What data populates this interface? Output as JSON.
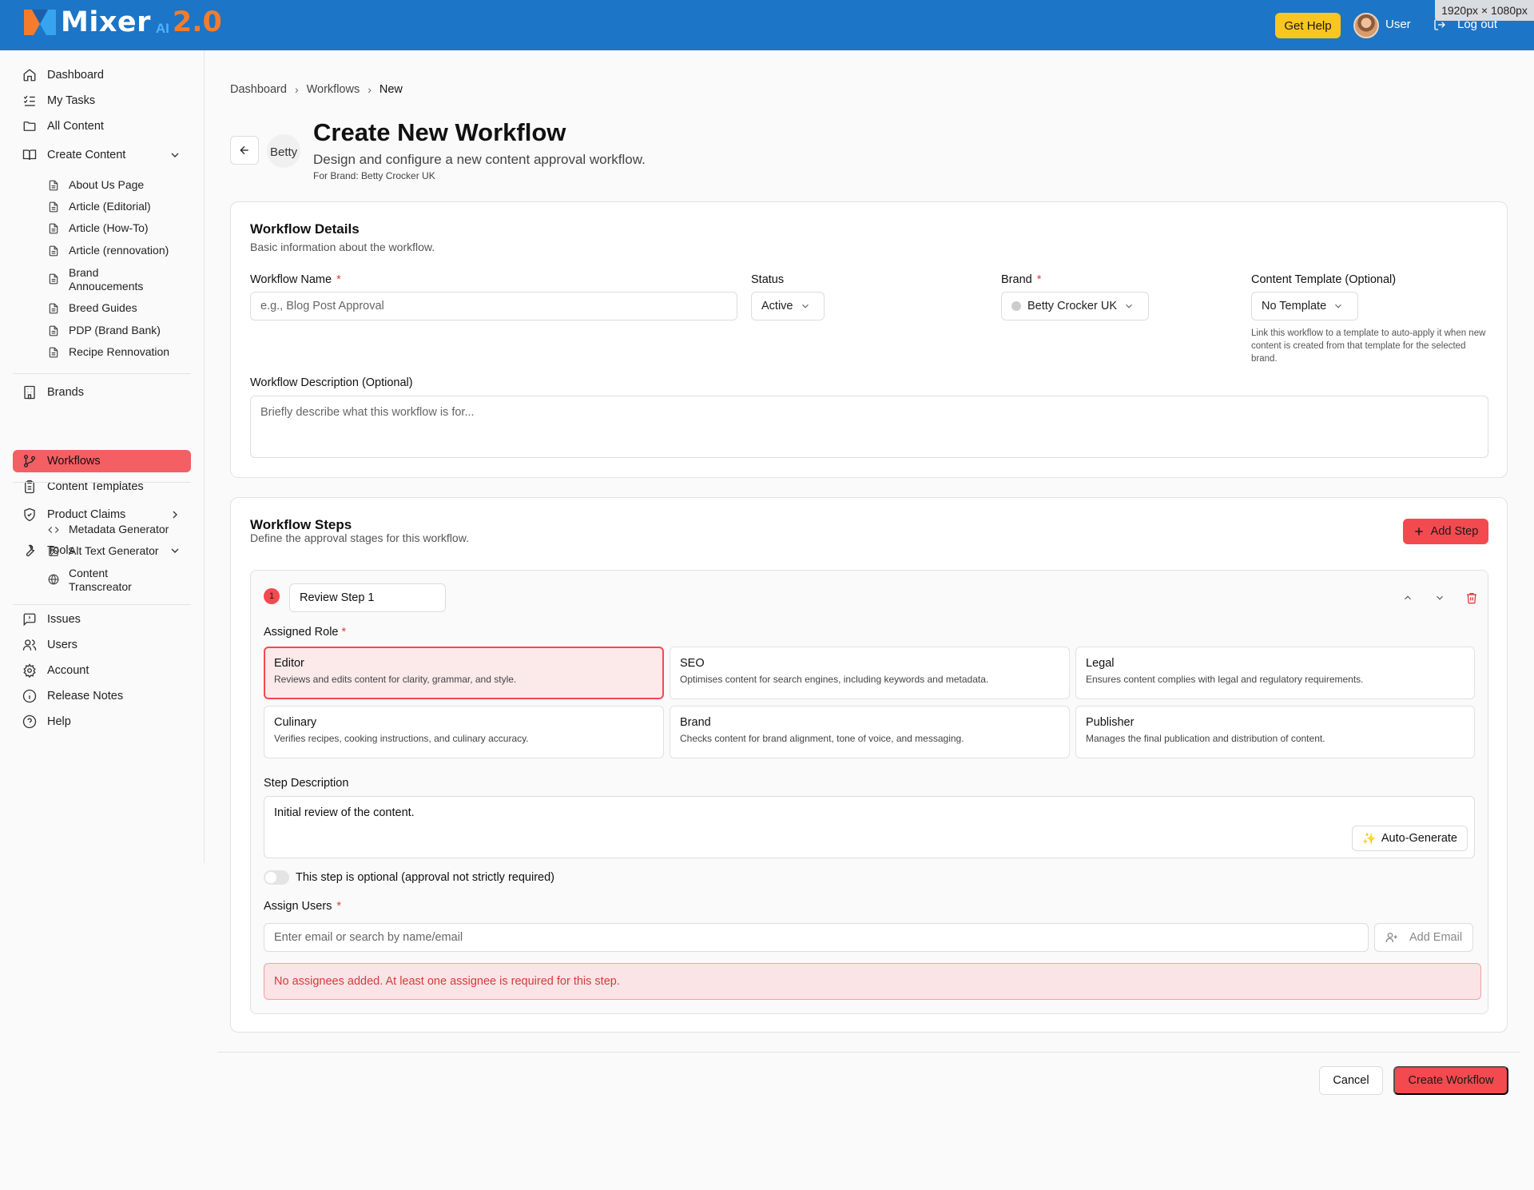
{
  "header": {
    "logo_text": "Mixer",
    "logo_ai": "AI",
    "logo_version": "2.0",
    "get_help_label": "Get Help",
    "user_label": "User",
    "logout_label": "Log out",
    "dimensions_badge": "1920px × 1080px",
    "brand_color": "#1c75c6",
    "accent_color": "#f24a4f"
  },
  "sidebar": {
    "items": [
      {
        "label": "Dashboard",
        "icon": "home-icon"
      },
      {
        "label": "My Tasks",
        "icon": "list-check-icon"
      },
      {
        "label": "All Content",
        "icon": "folder-icon"
      },
      {
        "label": "Create Content",
        "icon": "book-open-icon"
      },
      {
        "label": "Brands",
        "icon": "building-icon"
      },
      {
        "label": "Workflows",
        "icon": "git-branch-icon"
      },
      {
        "label": "Content Templates",
        "icon": "clipboard-icon"
      },
      {
        "label": "Product Claims",
        "icon": "shield-check-icon"
      },
      {
        "label": "Tools",
        "icon": "wrench-icon"
      },
      {
        "label": "Issues",
        "icon": "message-alert-icon"
      },
      {
        "label": "Users",
        "icon": "users-icon"
      },
      {
        "label": "Account",
        "icon": "gear-icon"
      },
      {
        "label": "Release Notes",
        "icon": "info-icon"
      },
      {
        "label": "Help",
        "icon": "help-circle-icon"
      }
    ],
    "create_content_sub": [
      "About Us Page",
      "Article (Editorial)",
      "Article (How-To)",
      "Article (rennovation)",
      "Brand Annoucements",
      "Breed Guides",
      "PDP (Brand Bank)",
      "Recipe Rennovation"
    ],
    "tools_sub": [
      {
        "label": "Metadata Generator",
        "icon": "code-icon"
      },
      {
        "label": "Alt Text Generator",
        "icon": "image-icon"
      },
      {
        "label": "Content Transcreator",
        "icon": "globe-icon"
      }
    ]
  },
  "breadcrumb": [
    "Dashboard",
    "Workflows",
    "New"
  ],
  "page": {
    "title": "Create New Workflow",
    "subtitle": "Design and configure a new content approval workflow.",
    "brand_line": "For Brand: Betty Crocker UK",
    "brand_logo_alt": "Betty"
  },
  "details": {
    "title": "Workflow Details",
    "subtitle": "Basic information about the workflow.",
    "name_label": "Workflow Name",
    "name_placeholder": "e.g., Blog Post Approval",
    "status_label": "Status",
    "status_value": "Active",
    "brand_label": "Brand",
    "brand_value": "Betty Crocker UK",
    "template_label": "Content Template (Optional)",
    "template_value": "No Template",
    "template_help": "Link this workflow to a template to auto-apply it when new content is created from that template for the selected brand.",
    "description_label": "Workflow Description (Optional)",
    "description_placeholder": "Briefly describe what this workflow is for..."
  },
  "steps": {
    "title": "Workflow Steps",
    "subtitle": "Define the approval stages for this workflow.",
    "add_step_label": "Add Step",
    "step": {
      "number": "1",
      "name": "Review Step 1",
      "role_label": "Assigned Role",
      "roles": [
        {
          "name": "Editor",
          "desc": "Reviews and edits content for clarity, grammar, and style.",
          "selected": true
        },
        {
          "name": "SEO",
          "desc": "Optimises content for search engines, including keywords and metadata.",
          "selected": false
        },
        {
          "name": "Legal",
          "desc": "Ensures content complies with legal and regulatory requirements.",
          "selected": false
        },
        {
          "name": "Culinary",
          "desc": "Verifies recipes, cooking instructions, and culinary accuracy.",
          "selected": false
        },
        {
          "name": "Brand",
          "desc": "Checks content for brand alignment, tone of voice, and messaging.",
          "selected": false
        },
        {
          "name": "Publisher",
          "desc": "Manages the final publication and distribution of content.",
          "selected": false
        }
      ],
      "description_label": "Step Description",
      "description_value": "Initial review of the content.",
      "auto_generate_label": "Auto-Generate",
      "optional_label": "This step is optional (approval not strictly required)",
      "assign_users_label": "Assign Users",
      "assign_placeholder": "Enter email or search by name/email",
      "add_email_label": "Add Email",
      "error_message": "No assignees added. At least one assignee is required for this step."
    }
  },
  "footer": {
    "cancel_label": "Cancel",
    "create_label": "Create Workflow"
  }
}
